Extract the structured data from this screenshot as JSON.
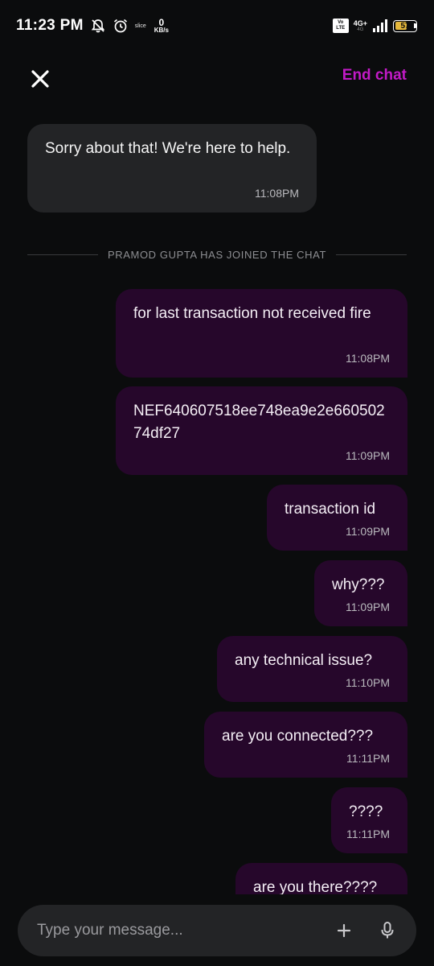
{
  "status_bar": {
    "time": "11:23 PM",
    "slice_label": "slice",
    "net_speed_value": "0",
    "net_speed_unit": "KB/s",
    "volte_label": "Vo LTE",
    "network_label": "4G+",
    "network_sub": "4G",
    "battery_level": "57",
    "battery_fraction": 0.57,
    "battery_color": "#e5b83c"
  },
  "header": {
    "close_icon": "close-icon",
    "end_chat_label": "End chat",
    "accent_color": "#c21ac6"
  },
  "chat": {
    "messages": [
      {
        "sender": "agent",
        "text": "Sorry about that! We're here to help.",
        "time": "11:08PM"
      },
      {
        "sender": "user",
        "text": "for last transaction not received fire",
        "time": "11:08PM"
      },
      {
        "sender": "user",
        "text": "NEF640607518ee748ea9e2e66050274df27",
        "time": "11:09PM"
      },
      {
        "sender": "user",
        "text": "transaction id",
        "time": "11:09PM"
      },
      {
        "sender": "user",
        "text": "why???",
        "time": "11:09PM"
      },
      {
        "sender": "user",
        "text": "any technical issue?",
        "time": "11:10PM"
      },
      {
        "sender": "user",
        "text": "are you connected???",
        "time": "11:11PM"
      },
      {
        "sender": "user",
        "text": "????",
        "time": "11:11PM"
      },
      {
        "sender": "user",
        "text": "are you there????",
        "time": ""
      }
    ],
    "system_notice": "PRAMOD GUPTA HAS JOINED THE CHAT"
  },
  "composer": {
    "placeholder": "Type your message...",
    "value": "",
    "attach_icon": "plus-icon",
    "mic_icon": "microphone-icon"
  }
}
